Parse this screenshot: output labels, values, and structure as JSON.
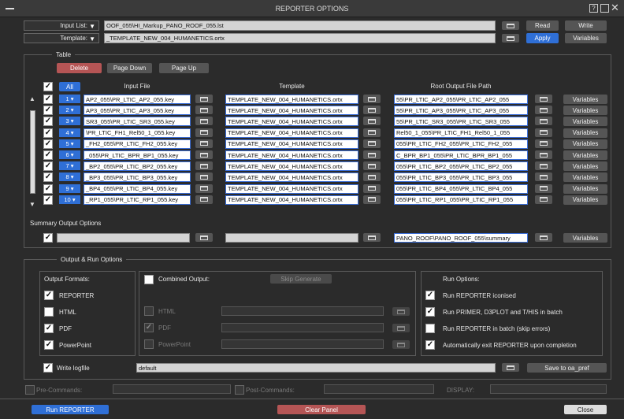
{
  "window": {
    "title": "REPORTER OPTIONS",
    "help_icon": "?"
  },
  "top": {
    "input_list_label": "Input List:",
    "input_list_value": "OOF_055\\HI_Markup_PANO_ROOF_055.lst",
    "template_label": "Template:",
    "template_value": "_TEMPLATE_NEW_004_HUMANETICS.ortx",
    "read": "Read",
    "write": "Write",
    "apply": "Apply",
    "variables": "Variables"
  },
  "table": {
    "section": "Table",
    "delete": "Delete",
    "page_down": "Page Down",
    "page_up": "Page Up",
    "all": "All",
    "col_input": "Input File",
    "col_template": "Template",
    "col_output": "Root Output File Path",
    "variables": "Variables",
    "rows": [
      {
        "num": "1 ▾",
        "input": "AP2_055\\PR_LTIC_AP2_055.key",
        "template": "TEMPLATE_NEW_004_HUMANETICS.ortx",
        "output": "55\\PR_LTIC_AP2_055\\PR_LTIC_AP2_055"
      },
      {
        "num": "2 ▾",
        "input": "AP3_055\\PR_LTIC_AP3_055.key",
        "template": "TEMPLATE_NEW_004_HUMANETICS.ortx",
        "output": "55\\PR_LTIC_AP3_055\\PR_LTIC_AP3_055"
      },
      {
        "num": "3 ▾",
        "input": "SR3_055\\PR_LTIC_SR3_055.key",
        "template": "TEMPLATE_NEW_004_HUMANETICS.ortx",
        "output": "55\\PR_LTIC_SR3_055\\PR_LTIC_SR3_055"
      },
      {
        "num": "4 ▾",
        "input": "\\PR_LTIC_FH1_Rel50_1_055.key",
        "template": "TEMPLATE_NEW_004_HUMANETICS.ortx",
        "output": "Rel50_1_055\\PR_LTIC_FH1_Rel50_1_055"
      },
      {
        "num": "5 ▾",
        "input": "_FH2_055\\PR_LTIC_FH2_055.key",
        "template": "TEMPLATE_NEW_004_HUMANETICS.ortx",
        "output": "055\\PR_LTIC_FH2_055\\PR_LTIC_FH2_055"
      },
      {
        "num": "6 ▾",
        "input": "_055\\PR_LTIC_BPR_BP1_055.key",
        "template": "TEMPLATE_NEW_004_HUMANETICS.ortx",
        "output": "C_BPR_BP1_055\\PR_LTIC_BPR_BP1_055"
      },
      {
        "num": "7 ▾",
        "input": "_BP2_055\\PR_LTIC_BP2_055.key",
        "template": "TEMPLATE_NEW_004_HUMANETICS.ortx",
        "output": "055\\PR_LTIC_BP2_055\\PR_LTIC_BP2_055"
      },
      {
        "num": "8 ▾",
        "input": "_BP3_055\\PR_LTIC_BP3_055.key",
        "template": "TEMPLATE_NEW_004_HUMANETICS.ortx",
        "output": "055\\PR_LTIC_BP3_055\\PR_LTIC_BP3_055"
      },
      {
        "num": "9 ▾",
        "input": "_BP4_055\\PR_LTIC_BP4_055.key",
        "template": "TEMPLATE_NEW_004_HUMANETICS.ortx",
        "output": "055\\PR_LTIC_BP4_055\\PR_LTIC_BP4_055"
      },
      {
        "num": "10 ▾",
        "input": "_RP1_055\\PR_LTIC_RP1_055.key",
        "template": "TEMPLATE_NEW_004_HUMANETICS.ortx",
        "output": "055\\PR_LTIC_RP1_055\\PR_LTIC_RP1_055"
      }
    ],
    "summary_label": "Summary Output Options",
    "summary_output": "PANO_ROOF\\PANO_ROOF_055\\summary"
  },
  "run": {
    "section": "Output & Run Options",
    "formats_label": "Output Formats:",
    "formats": [
      {
        "label": "REPORTER",
        "checked": true
      },
      {
        "label": "HTML",
        "checked": false
      },
      {
        "label": "PDF",
        "checked": true
      },
      {
        "label": "PowerPoint",
        "checked": true
      }
    ],
    "combined_label": "Combined Output:",
    "skip_generate": "Skip Generate",
    "combined": [
      {
        "label": "HTML",
        "checked": false
      },
      {
        "label": "PDF",
        "checked": true
      },
      {
        "label": "PowerPoint",
        "checked": false
      }
    ],
    "run_options_label": "Run Options:",
    "run_options": [
      {
        "label": "Run REPORTER iconised",
        "checked": true
      },
      {
        "label": "Run PRIMER, D3PLOT and T/HIS in batch",
        "checked": true
      },
      {
        "label": "Run REPORTER in batch (skip errors)",
        "checked": false
      },
      {
        "label": "Automatically exit REPORTER upon completion",
        "checked": true
      }
    ],
    "write_logfile": "Write logfile",
    "logfile_value": "default",
    "save_pref": "Save to oa_pref"
  },
  "bottom": {
    "pre_commands": "Pre-Commands:",
    "post_commands": "Post-Commands:",
    "display": "DISPLAY:",
    "run_reporter": "Run REPORTER",
    "clear_panel": "Clear Panel",
    "close": "Close"
  }
}
